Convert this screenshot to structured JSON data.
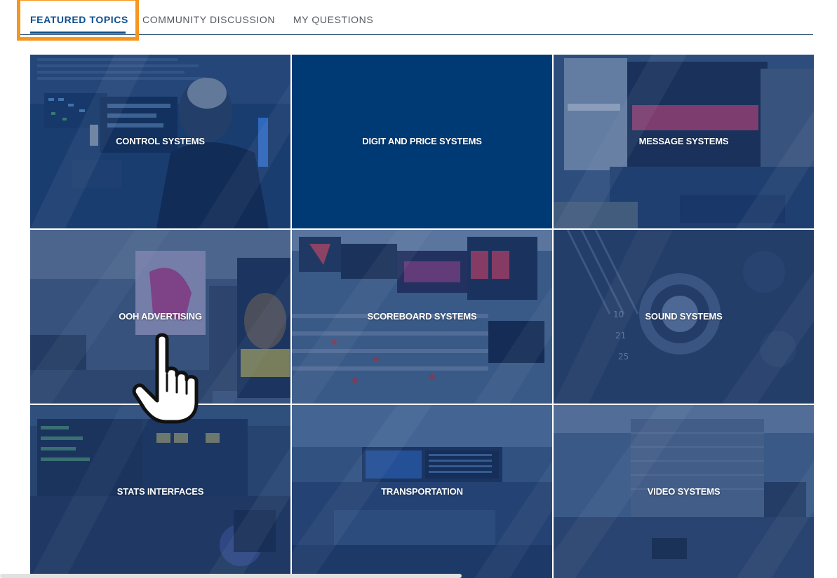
{
  "tabs": [
    {
      "label": "FEATURED TOPICS",
      "active": true
    },
    {
      "label": "COMMUNITY DISCUSSION",
      "active": false
    },
    {
      "label": "MY QUESTIONS",
      "active": false
    }
  ],
  "topics": [
    {
      "label": "CONTROL SYSTEMS"
    },
    {
      "label": "DIGIT AND PRICE SYSTEMS"
    },
    {
      "label": "MESSAGE SYSTEMS"
    },
    {
      "label": "OOH ADVERTISING"
    },
    {
      "label": "SCOREBOARD SYSTEMS"
    },
    {
      "label": "SOUND SYSTEMS"
    },
    {
      "label": "STATS INTERFACES"
    },
    {
      "label": "TRANSPORTATION"
    },
    {
      "label": "VIDEO SYSTEMS"
    }
  ],
  "colors": {
    "brand_blue": "#0d4e8f",
    "tile_overlay": "#173f78",
    "tile_solid": "#003a75",
    "highlight": "#f5961f"
  },
  "cursor_icon": "pointer-hand-icon"
}
